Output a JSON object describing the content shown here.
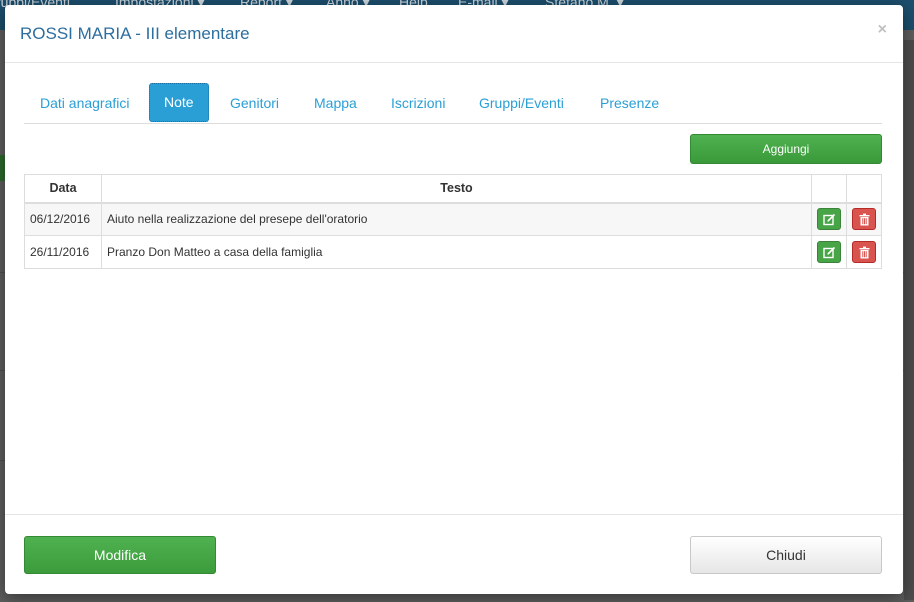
{
  "background": {
    "nav_items": [
      "ruppi/Eventi",
      "Impostazioni ▾",
      "Report ▾",
      "Anno ▾",
      "Help",
      "E-mail ▾",
      "Stefano M. ▾"
    ]
  },
  "modal": {
    "title": "ROSSI MARIA - III elementare",
    "close_icon": "×"
  },
  "tabs": [
    {
      "label": "Dati anagrafici",
      "active": false
    },
    {
      "label": "Note",
      "active": true
    },
    {
      "label": "Genitori",
      "active": false
    },
    {
      "label": "Mappa",
      "active": false
    },
    {
      "label": "Iscrizioni",
      "active": false
    },
    {
      "label": "Gruppi/Eventi",
      "active": false
    },
    {
      "label": "Presenze",
      "active": false
    }
  ],
  "add_button": "Aggiungi",
  "table": {
    "headers": [
      "Data",
      "Testo",
      "",
      ""
    ],
    "rows": [
      {
        "data": "06/12/2016",
        "testo": "Aiuto nella realizzazione del presepe dell'oratorio",
        "edit_icon": "edit-icon",
        "delete_icon": "trash-icon"
      },
      {
        "data": "26/11/2016",
        "testo": "Pranzo Don Matteo a casa della famiglia",
        "edit_icon": "edit-icon",
        "delete_icon": "trash-icon"
      }
    ]
  },
  "footer": {
    "modifica": "Modifica",
    "chiudi": "Chiudi"
  },
  "colors": {
    "accent": "#2a9fd6",
    "success": "#47a447",
    "danger": "#d9534f",
    "title": "#2c6e9e"
  }
}
